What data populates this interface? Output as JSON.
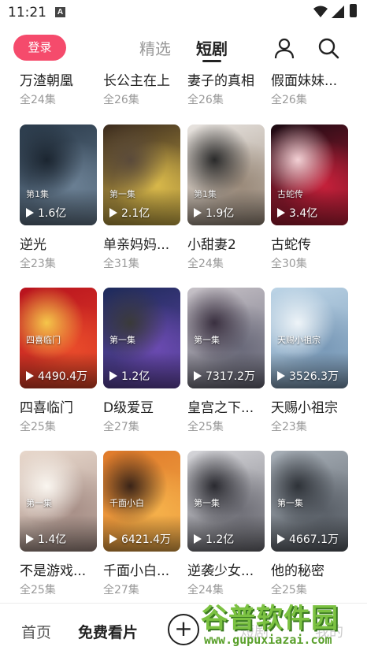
{
  "status_bar": {
    "time": "11:21",
    "notification_icon": "A"
  },
  "header": {
    "login_label": "登录",
    "tabs": [
      {
        "label": "精选",
        "active": false
      },
      {
        "label": "短剧",
        "active": true
      }
    ],
    "icons": [
      "user-icon",
      "search-icon"
    ]
  },
  "top_row": [
    {
      "title": "万渣朝凰",
      "episodes": "全24集"
    },
    {
      "title": "长公主在上",
      "episodes": "全26集"
    },
    {
      "title": "妻子的真相",
      "episodes": "全26集"
    },
    {
      "title": "假面妹妹...",
      "episodes": "全26集"
    }
  ],
  "rows": [
    [
      {
        "title": "逆光",
        "episodes": "全23集",
        "plays": "1.6亿",
        "poster_text": "第1集",
        "colors": [
          "#2a3a4a",
          "#6a7f93",
          "#1b2530"
        ]
      },
      {
        "title": "单亲妈妈...",
        "episodes": "全31集",
        "plays": "2.1亿",
        "poster_text": "第一集",
        "colors": [
          "#3b2b1e",
          "#d8b84a",
          "#5a4a3a"
        ]
      },
      {
        "title": "小甜妻2",
        "episodes": "全24集",
        "plays": "1.9亿",
        "poster_text": "第1集",
        "colors": [
          "#e8e4e0",
          "#9a8a7a",
          "#2a2a2a"
        ]
      },
      {
        "title": "古蛇传",
        "episodes": "全30集",
        "plays": "3.4亿",
        "poster_text": "古蛇传",
        "colors": [
          "#1a0a12",
          "#c4203a",
          "#f2d0d4"
        ]
      }
    ],
    [
      {
        "title": "四喜临门",
        "episodes": "全25集",
        "plays": "4490.4万",
        "poster_text": "四喜临门",
        "colors": [
          "#b8121e",
          "#e84a2a",
          "#f5c64a"
        ]
      },
      {
        "title": "D级爱豆",
        "episodes": "全27集",
        "plays": "1.2亿",
        "poster_text": "第一集",
        "colors": [
          "#1d2a5a",
          "#6a4ab0",
          "#3a3a3a"
        ]
      },
      {
        "title": "皇宫之下...",
        "episodes": "全25集",
        "plays": "7317.2万",
        "poster_text": "第一集",
        "colors": [
          "#c7c2c8",
          "#6a6a7a",
          "#3a3040"
        ]
      },
      {
        "title": "天赐小祖宗",
        "episodes": "全23集",
        "plays": "3526.3万",
        "poster_text": "天赐小祖宗",
        "colors": [
          "#bcd4e6",
          "#7a9ab8",
          "#eef4f8"
        ]
      }
    ],
    [
      {
        "title": "不是游戏...",
        "episodes": "全25集",
        "plays": "1.4亿",
        "poster_text": "第一集",
        "colors": [
          "#e8d8cc",
          "#a89088",
          "#faf6f0"
        ]
      },
      {
        "title": "千面小白...",
        "episodes": "全27集",
        "plays": "6421.4万",
        "poster_text": "千面小白",
        "colors": [
          "#e07a2a",
          "#f5b04a",
          "#3a2418"
        ]
      },
      {
        "title": "逆袭少女...",
        "episodes": "全24集",
        "plays": "1.2亿",
        "poster_text": "第一集",
        "colors": [
          "#d6d6da",
          "#707078",
          "#2a2a30"
        ]
      },
      {
        "title": "他的秘密",
        "episodes": "全25集",
        "plays": "4667.1万",
        "poster_text": "第一集",
        "colors": [
          "#a8b0b8",
          "#5a6068",
          "#2e3238"
        ]
      }
    ]
  ],
  "bottom_nav": {
    "home_label": "首页",
    "free_label": "免费看片",
    "plus_label": "+",
    "faded_1": "短剧",
    "faded_2": "我的"
  },
  "watermark": {
    "title": "谷普软件园",
    "url": "www.gupuxiazai.com"
  }
}
